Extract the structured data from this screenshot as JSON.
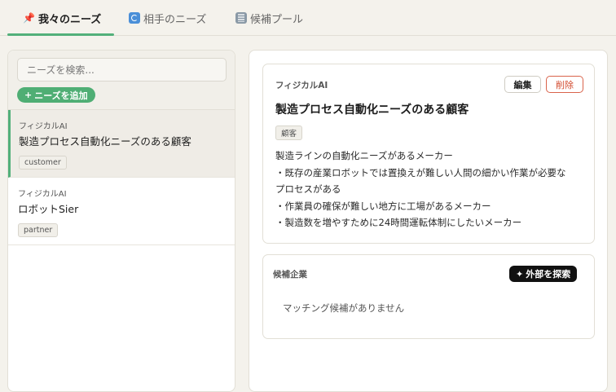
{
  "tabs": [
    {
      "label": "我々のニーズ",
      "icon": "📌",
      "active": true
    },
    {
      "label": "相手のニーズ",
      "icon": "refresh-icon",
      "active": false
    },
    {
      "label": "候補プール",
      "icon": "building-icon",
      "active": false
    }
  ],
  "sidebar": {
    "search_placeholder": "ニーズを検索...",
    "add_label": "ニーズを追加",
    "add_prefix": "+",
    "items": [
      {
        "category": "フィジカルAI",
        "title": "製造プロセス自動化ニーズのある顧客",
        "tag": "customer",
        "selected": true
      },
      {
        "category": "フィジカルAI",
        "title": "ロボットSier",
        "tag": "partner",
        "selected": false
      }
    ]
  },
  "detail": {
    "category": "フィジカルAI",
    "edit_label": "編集",
    "delete_label": "削除",
    "title": "製造プロセス自動化ニーズのある顧客",
    "tag": "顧客",
    "body": [
      "製造ラインの自動化ニーズがあるメーカー",
      "・既存の産業ロボットでは置換えが難しい人間の細かい作業が必要な",
      "プロセスがある",
      "・作業員の確保が難しい地方に工場があるメーカー",
      "・製造数を増やすために24時間運転体制にしたいメーカー"
    ]
  },
  "candidates": {
    "title": "候補企業",
    "explore_prefix": "✦",
    "explore_label": "外部を探索",
    "empty_text": "マッチング候補がありません"
  },
  "colors": {
    "accent": "#52b07a",
    "danger": "#d24a2e"
  }
}
